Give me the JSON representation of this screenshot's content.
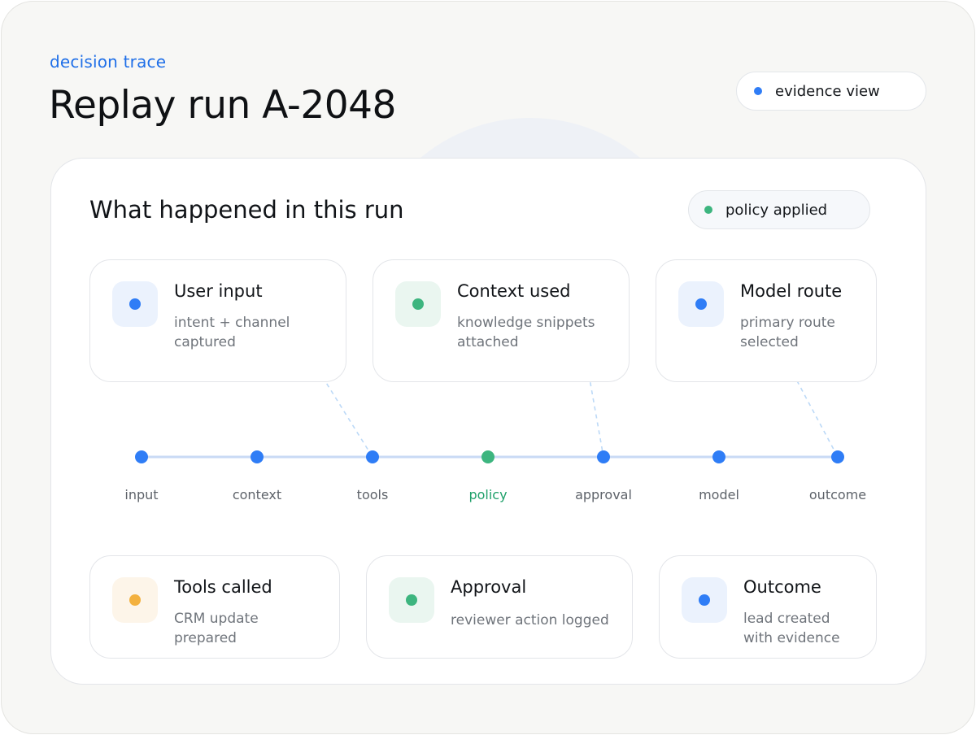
{
  "header": {
    "eyebrow": "decision trace",
    "title": "Replay run A-2048",
    "view_pill": {
      "label": "evidence view",
      "dot_color": "#2f7df6"
    }
  },
  "panel": {
    "title": "What happened in this run",
    "status_pill": {
      "label": "policy applied",
      "dot_color": "#3db57f"
    }
  },
  "top_cards": [
    {
      "title": "User input",
      "subtitle": "intent + channel captured",
      "dot_color": "#2f7df6",
      "badge_bg": "#ebf2fd"
    },
    {
      "title": "Context used",
      "subtitle": "knowledge snippets attached",
      "dot_color": "#3db57f",
      "badge_bg": "#eaf6f0"
    },
    {
      "title": "Model route",
      "subtitle": "primary route selected",
      "dot_color": "#2f7df6",
      "badge_bg": "#ebf2fd"
    }
  ],
  "bottom_cards": [
    {
      "title": "Tools called",
      "subtitle": "CRM update prepared",
      "dot_color": "#f3b13f",
      "badge_bg": "#fdf5e9"
    },
    {
      "title": "Approval",
      "subtitle": "reviewer action logged",
      "dot_color": "#3db57f",
      "badge_bg": "#eaf6f0"
    },
    {
      "title": "Outcome",
      "subtitle": "lead created with evidence",
      "dot_color": "#2f7df6",
      "badge_bg": "#ebf2fd"
    }
  ],
  "timeline": {
    "line_color": "#c9daf5",
    "steps": [
      {
        "label": "input",
        "color": "#2f7df6",
        "highlight": false
      },
      {
        "label": "context",
        "color": "#2f7df6",
        "highlight": false
      },
      {
        "label": "tools",
        "color": "#2f7df6",
        "highlight": false
      },
      {
        "label": "policy",
        "color": "#3db57f",
        "highlight": true
      },
      {
        "label": "approval",
        "color": "#2f7df6",
        "highlight": false
      },
      {
        "label": "model",
        "color": "#2f7df6",
        "highlight": false
      },
      {
        "label": "outcome",
        "color": "#2f7df6",
        "highlight": false
      }
    ],
    "links": [
      {
        "card": "top_cards.0",
        "step": "tools"
      },
      {
        "card": "top_cards.1",
        "step": "approval"
      },
      {
        "card": "top_cards.2",
        "step": "outcome"
      }
    ],
    "label_highlight_color": "#1fa06a"
  }
}
